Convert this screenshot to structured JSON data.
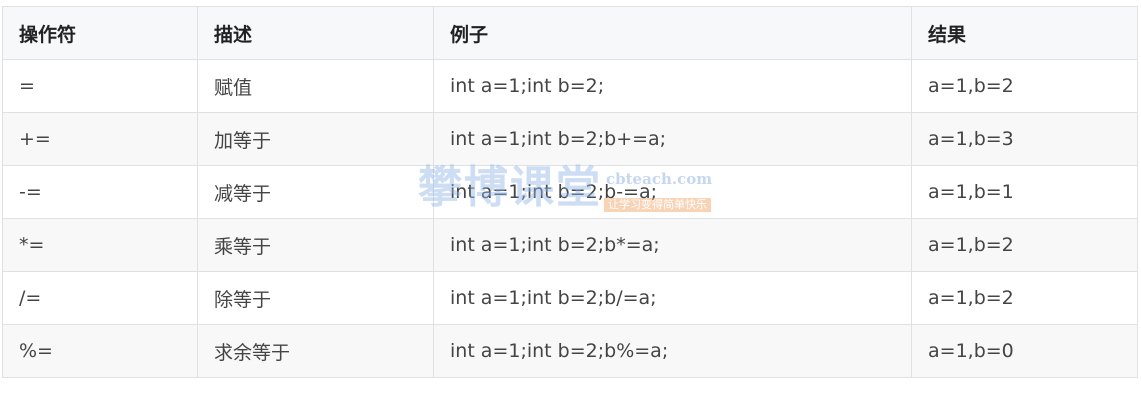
{
  "table": {
    "headers": [
      "操作符",
      "描述",
      "例子",
      "结果"
    ],
    "rows": [
      [
        "=",
        "赋值",
        "int a=1;int b=2;",
        "a=1,b=2"
      ],
      [
        "+=",
        "加等于",
        "int a=1;int b=2;b+=a;",
        "a=1,b=3"
      ],
      [
        "-=",
        "减等于",
        "int a=1;int b=2;b-=a;",
        "a=1,b=1"
      ],
      [
        "*=",
        "乘等于",
        "int a=1;int b=2;b*=a;",
        "a=1,b=2"
      ],
      [
        "/=",
        "除等于",
        "int a=1;int b=2;b/=a;",
        "a=1,b=2"
      ],
      [
        "%=",
        "求余等于",
        "int a=1;int b=2;b%=a;",
        "a=1,b=0"
      ]
    ]
  },
  "watermark": {
    "brand": "攀博课堂",
    "domain": "cbteach.com",
    "slogan": "让学习变得简单快乐"
  }
}
